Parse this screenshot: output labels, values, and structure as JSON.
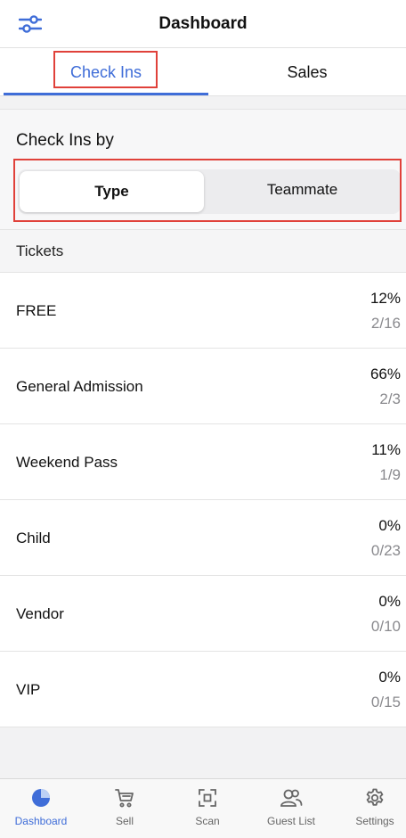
{
  "header": {
    "title": "Dashboard",
    "filter_icon": "sliders-icon"
  },
  "tabs": [
    {
      "label": "Check Ins",
      "active": true
    },
    {
      "label": "Sales",
      "active": false
    }
  ],
  "section": {
    "title": "Check Ins by",
    "segments": [
      {
        "label": "Type",
        "selected": true
      },
      {
        "label": "Teammate",
        "selected": false
      }
    ]
  },
  "group": {
    "title": "Tickets"
  },
  "tickets": [
    {
      "name": "FREE",
      "percent": "12%",
      "fraction": "2/16"
    },
    {
      "name": "General Admission",
      "percent": "66%",
      "fraction": "2/3"
    },
    {
      "name": "Weekend Pass",
      "percent": "11%",
      "fraction": "1/9"
    },
    {
      "name": "Child",
      "percent": "0%",
      "fraction": "0/23"
    },
    {
      "name": "Vendor",
      "percent": "0%",
      "fraction": "0/10"
    },
    {
      "name": "VIP",
      "percent": "0%",
      "fraction": "0/15"
    }
  ],
  "nav": [
    {
      "label": "Dashboard",
      "icon": "pie-chart-icon",
      "active": true
    },
    {
      "label": "Sell",
      "icon": "cart-icon",
      "active": false
    },
    {
      "label": "Scan",
      "icon": "scan-icon",
      "active": false
    },
    {
      "label": "Guest List",
      "icon": "guests-icon",
      "active": false
    },
    {
      "label": "Settings",
      "icon": "gear-icon",
      "active": false
    }
  ],
  "colors": {
    "accent": "#3f6dd8",
    "highlight": "#e0413a",
    "background": "#f2f2f3"
  }
}
